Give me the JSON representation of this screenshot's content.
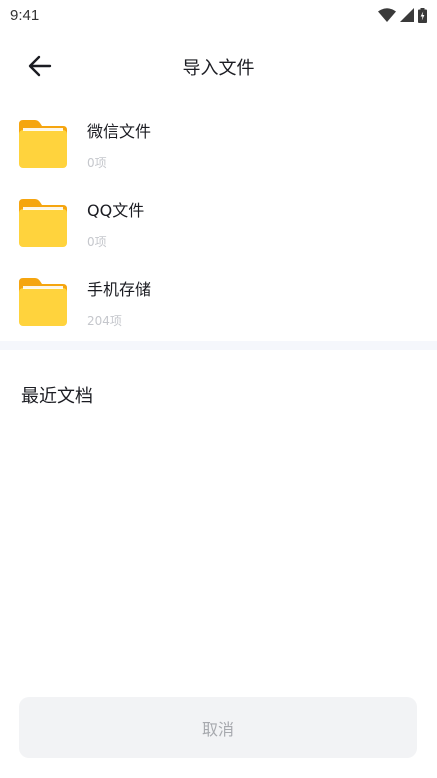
{
  "status_bar": {
    "time": "9:41",
    "icons": [
      "wifi-icon",
      "signal-icon",
      "battery-icon"
    ]
  },
  "header": {
    "back_icon": "arrow-left-icon",
    "title": "导入文件"
  },
  "folders": [
    {
      "name": "微信文件",
      "count": "0项",
      "icon": "folder-icon"
    },
    {
      "name": "QQ文件",
      "count": "0项",
      "icon": "folder-icon"
    },
    {
      "name": "手机存储",
      "count": "204项",
      "icon": "folder-icon"
    }
  ],
  "recent": {
    "title": "最近文档"
  },
  "footer": {
    "cancel_label": "取消"
  },
  "colors": {
    "folder_top": "#f5a50f",
    "folder_body": "#ffd33d",
    "divider": "#f5f7fc",
    "button_bg": "#f2f3f5",
    "button_text": "#a7a9ae",
    "secondary_text": "#c5c7cc"
  }
}
